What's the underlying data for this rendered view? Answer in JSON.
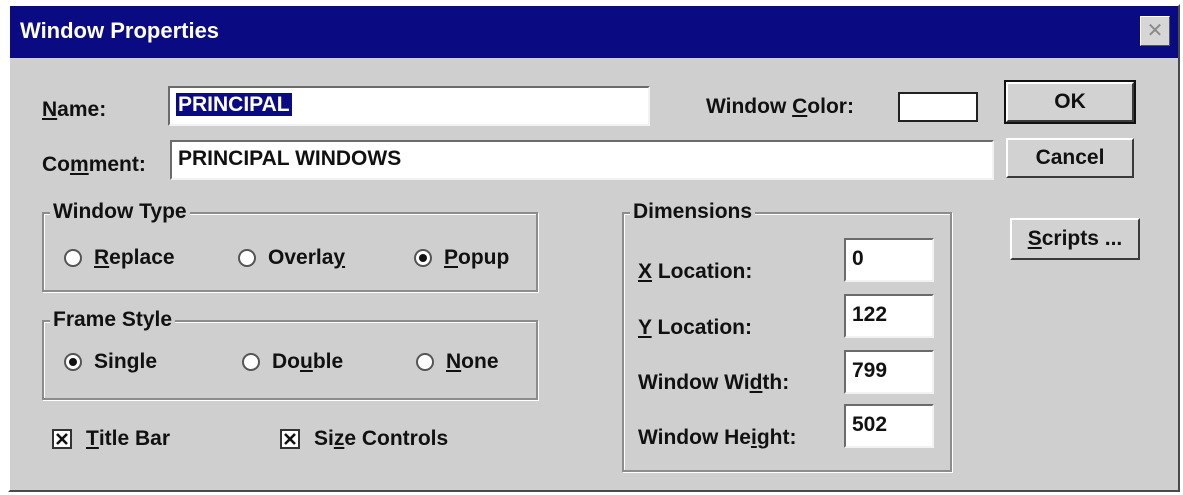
{
  "window": {
    "title": "Window Properties"
  },
  "name": {
    "label_pre": "",
    "label_key": "N",
    "label_post": "ame:",
    "value": "PRINCIPAL"
  },
  "window_color": {
    "label_pre": "Window ",
    "label_key": "C",
    "label_post": "olor:",
    "swatch_color": "#ffffff"
  },
  "comment": {
    "label_pre": "Co",
    "label_key": "m",
    "label_post": "ment:",
    "value": "PRINCIPAL WINDOWS"
  },
  "buttons": {
    "ok": "OK",
    "cancel": "Cancel",
    "scripts_key": "S",
    "scripts_rest": "cripts ..."
  },
  "window_type": {
    "title": "Window Type",
    "options": [
      {
        "pre": "",
        "key": "R",
        "post": "eplace",
        "selected": false
      },
      {
        "pre": "Overla",
        "key": "y",
        "post": "",
        "selected": false
      },
      {
        "pre": "",
        "key": "P",
        "post": "opup",
        "selected": true
      }
    ]
  },
  "frame_style": {
    "title": "Frame Style",
    "options": [
      {
        "pre": "Sin",
        "key": "g",
        "post": "le",
        "selected": true
      },
      {
        "pre": "Do",
        "key": "u",
        "post": "ble",
        "selected": false
      },
      {
        "pre": "",
        "key": "N",
        "post": "one",
        "selected": false
      }
    ]
  },
  "checkboxes": [
    {
      "pre": "",
      "key": "T",
      "post": "itle Bar",
      "checked": true
    },
    {
      "pre": "Si",
      "key": "z",
      "post": "e Controls",
      "checked": true
    }
  ],
  "dimensions": {
    "title": "Dimensions",
    "fields": [
      {
        "pre": "",
        "key": "X",
        "post": " Location:",
        "value": "0"
      },
      {
        "pre": "",
        "key": "Y",
        "post": " Location:",
        "value": "122"
      },
      {
        "pre": "Window Wi",
        "key": "d",
        "post": "th:",
        "value": "799"
      },
      {
        "pre": "Window He",
        "key": "i",
        "post": "ght:",
        "value": "502"
      }
    ]
  }
}
